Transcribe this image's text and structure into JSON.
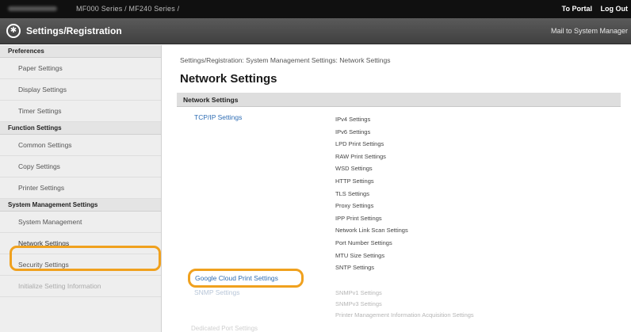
{
  "topbar": {
    "model": "MF000 Series / MF240 Series /",
    "portal_label": "To Portal",
    "logout_label": "Log Out"
  },
  "titlebar": {
    "title": "Settings/Registration",
    "mail_label": "Mail to System Manager"
  },
  "sidebar": {
    "preferences_heading": "Preferences",
    "paper_settings": "Paper Settings",
    "display_settings": "Display Settings",
    "timer_settings": "Timer Settings",
    "function_heading": "Function Settings",
    "common_settings": "Common Settings",
    "copy_settings": "Copy Settings",
    "printer_settings": "Printer Settings",
    "system_heading": "System Management Settings",
    "system_management": "System Management",
    "network_settings": "Network Settings",
    "security_settings": "Security Settings",
    "initialize_settings": "Initialize Setting Information"
  },
  "main": {
    "breadcrumb": "Settings/Registration: System Management Settings: Network Settings",
    "title": "Network Settings",
    "section_title": "Network Settings",
    "tcpip_link": "TCP/IP Settings",
    "tcpip_items": [
      "IPv4 Settings",
      "IPv6 Settings",
      "LPD Print Settings",
      "RAW Print Settings",
      "WSD Settings",
      "HTTP Settings",
      "TLS Settings",
      "Proxy Settings",
      "IPP Print Settings",
      "Network Link Scan Settings",
      "Port Number Settings",
      "MTU Size Settings",
      "SNTP Settings"
    ],
    "google_cloud_link": "Google Cloud Print Settings",
    "snmp_link": "SNMP Settings",
    "snmp_items": [
      "SNMPv1 Settings",
      "SNMPv3 Settings",
      "Printer Management Information Acquisition Settings"
    ],
    "dedicated_port_label": "Dedicated Port Settings"
  },
  "colors": {
    "highlight": "#f0a11e",
    "link": "#2e6db4",
    "topbar": "#101010",
    "titlebar": "#4a4a4a"
  }
}
